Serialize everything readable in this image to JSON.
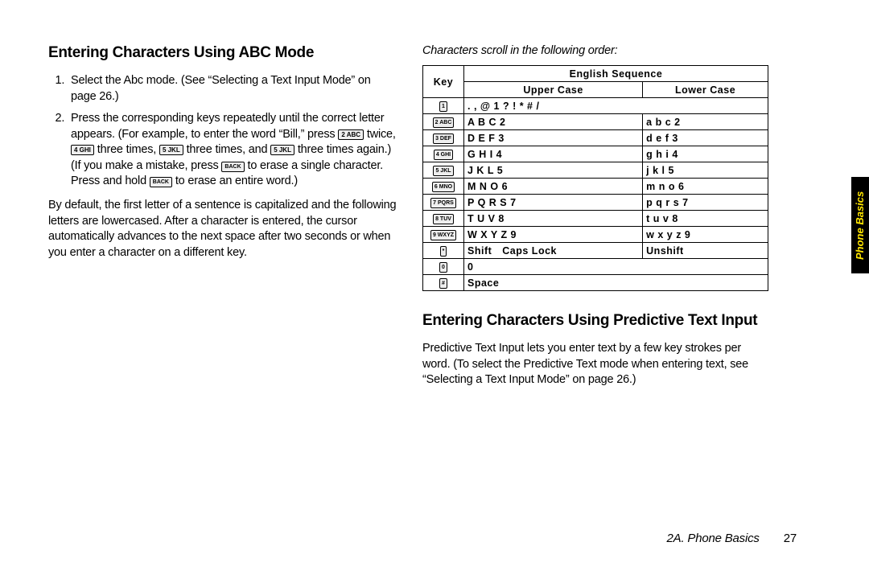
{
  "side_tab": "Phone Basics",
  "footer": {
    "section": "2A. Phone Basics",
    "page_num": "27"
  },
  "left": {
    "heading": "Entering Characters Using ABC Mode",
    "step1": "Select the Abc mode. (See “Selecting a Text Input Mode” on page 26.)",
    "step2a": "Press the corresponding keys repeatedly until the correct letter appears. (For example, to enter the word “Bill,” press ",
    "step2b": " twice, ",
    "step2c": " three times, ",
    "step2d": " three times, and ",
    "step2e": " three times again.) (If you make a mistake, press ",
    "step2f": " to erase a single character. Press and hold ",
    "step2g": " to erase an entire word.)",
    "body": "By default, the first letter of a sentence is capitalized and the following letters are lowercased. After a character is entered, the cursor automatically advances to the next space after two seconds or when you enter a character on a different key."
  },
  "right": {
    "intro": "Characters scroll in the following order:",
    "heading2": "Entering Characters Using Predictive Text Input",
    "body2": "Predictive Text Input lets you enter text by a few key strokes per word. (To select the Predictive Text mode when entering text, see “Selecting a Text Input Mode” on page 26.)"
  },
  "chart_data": {
    "type": "table",
    "title": "English Sequence",
    "columns": [
      "Key",
      "Upper Case",
      "Lower Case"
    ],
    "rows": [
      {
        "key": "1",
        "upper": ". , @ 1 ? ! * # /",
        "lower": ""
      },
      {
        "key": "2 ABC",
        "upper": "A B C 2",
        "lower": "a b c 2"
      },
      {
        "key": "3 DEF",
        "upper": "D E F 3",
        "lower": "d e f 3"
      },
      {
        "key": "4 GHI",
        "upper": "G H I 4",
        "lower": "g h i 4"
      },
      {
        "key": "5 JKL",
        "upper": "J K L 5",
        "lower": "j k l 5"
      },
      {
        "key": "6 MNO",
        "upper": "M N O 6",
        "lower": "m n o 6"
      },
      {
        "key": "7 PQRS",
        "upper": "P Q R S 7",
        "lower": "p q r s 7"
      },
      {
        "key": "8 TUV",
        "upper": "T U V 8",
        "lower": "t u v 8"
      },
      {
        "key": "9 WXYZ",
        "upper": "W X Y Z 9",
        "lower": "w x y z 9"
      },
      {
        "key": "*",
        "upper": "Shift Caps Lock",
        "lower": "Unshift"
      },
      {
        "key": "0",
        "upper": "0",
        "lower": ""
      },
      {
        "key": "#",
        "upper": "Space",
        "lower": ""
      }
    ],
    "header_key": "Key",
    "header_seq": "English Sequence",
    "header_upper": "Upper Case",
    "header_lower": "Lower Case"
  },
  "keycaps": {
    "k2": "2 ABC",
    "k4": "4 GHI",
    "k5": "5 JKL",
    "back": "BACK"
  }
}
